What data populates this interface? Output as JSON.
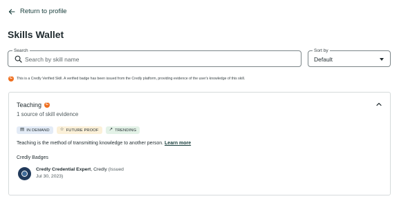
{
  "nav": {
    "back_label": "Return to profile"
  },
  "page": {
    "title": "Skills Wallet"
  },
  "search": {
    "legend": "Search",
    "placeholder": "Search by skill name",
    "value": ""
  },
  "sort": {
    "legend": "Sort by",
    "selected": "Default"
  },
  "notice": {
    "icon": "credly-icon",
    "text": "This is a Credly Verified Skill. A verified badge has been issued from the Credly platform, providing evidence of the user's knowledge of this skill."
  },
  "skill": {
    "name": "Teaching",
    "evidence": "1 source of skill evidence",
    "tags": [
      {
        "label": "IN DEMAND",
        "icon": "document-icon"
      },
      {
        "label": "FUTURE PROOF",
        "icon": "star-icon"
      },
      {
        "label": "TRENDING",
        "icon": "trending-icon"
      }
    ],
    "description": "Teaching is the method of transmitting knowledge to another person.",
    "learn_more": "Learn more",
    "badges_heading": "Credly Badges",
    "badges": [
      {
        "name": "Credly Credential Expert",
        "issuer": ", Credly",
        "issued_line1": "(Issued",
        "issued_line2": "Jul 30, 2023)"
      }
    ]
  },
  "colors": {
    "accent": "#163c3a",
    "credly_orange": "#ef6f1f",
    "tag_demand_bg": "#e3ebf6",
    "tag_future_bg": "#fbf0d8",
    "tag_trend_bg": "#e3f2e7"
  }
}
